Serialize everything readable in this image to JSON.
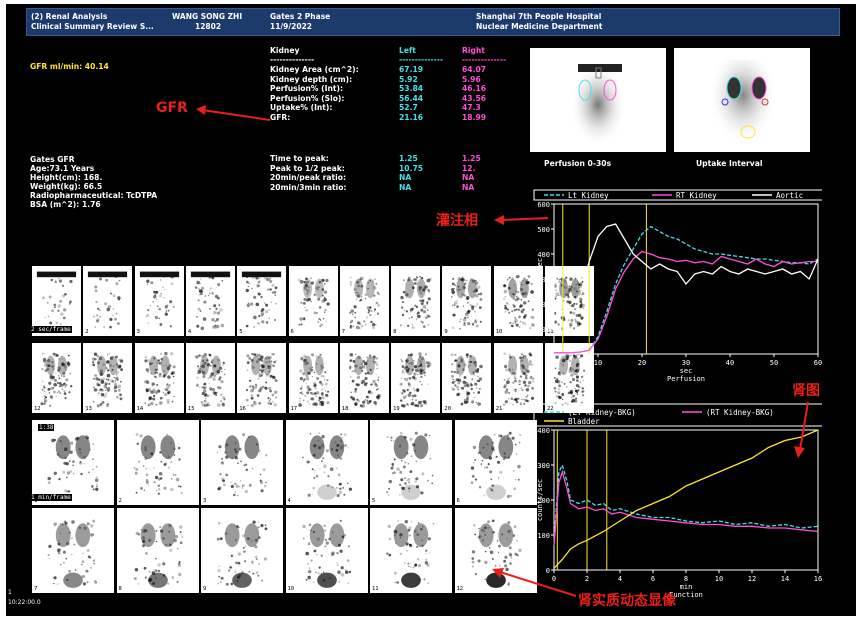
{
  "header": {
    "line1": "(2) Renal Analysis",
    "line2": "Clinical Summary Review S...",
    "patient_name": "WANG SONG ZHI",
    "patient_id": "12802",
    "protocol": "Gates 2 Phase",
    "date": "11/9/2022",
    "hospital": "Shanghai 7th People Hospital",
    "department": "Nuclear Medicine Department"
  },
  "gfr_total": "GFR ml/min: 40.14",
  "patient_info": {
    "title": "Gates GFR",
    "age": "Age:73.1 Years",
    "height": "Height(cm): 168.",
    "weight": "Weight(kg): 66.5",
    "radiopharm": "Radiopharmaceutical: TcDTPA",
    "bsa": "BSA (m^2): 1.76"
  },
  "kidney_table": {
    "header_label": "Kidney",
    "header_left": "Left",
    "header_right": "Right",
    "sep_label": "--------------",
    "sep_left": "--------------",
    "sep_right": "--------------",
    "rows": [
      {
        "label": "Kidney Area (cm^2):",
        "left": "67.19",
        "right": "64.07"
      },
      {
        "label": "Kidney depth (cm):",
        "left": "5.92",
        "right": "5.96"
      },
      {
        "label": "Perfusion% (Int):",
        "left": "53.84",
        "right": "46.16"
      },
      {
        "label": "Perfusion% (Slo):",
        "left": "56.44",
        "right": "43.56"
      },
      {
        "label": "Uptake% (Int):",
        "left": "52.7",
        "right": "47.3"
      },
      {
        "label": "GFR:",
        "left": "21.16",
        "right": "18.99"
      }
    ],
    "rows2": [
      {
        "label": "Time to peak:",
        "left": "1.25",
        "right": "1.25"
      },
      {
        "label": "Peak to 1/2 peak:",
        "left": "10.75",
        "right": "12."
      },
      {
        "label": "20min/peak ratio:",
        "left": "NA",
        "right": "NA"
      },
      {
        "label": "20min/3min ratio:",
        "left": "NA",
        "right": "NA"
      }
    ]
  },
  "images": {
    "perfusion_caption": "Perfusion 0-30s",
    "uptake_caption": "Uptake Interval"
  },
  "dynamic": {
    "row1_label": "2 sec/frame",
    "row3_label": "1 min/frame",
    "row3_time": "1:38",
    "perf_numbers": [
      "1",
      "2",
      "3",
      "4",
      "5",
      "6",
      "7",
      "8",
      "9",
      "10",
      "11",
      "12",
      "13",
      "14",
      "15",
      "16",
      "17",
      "18",
      "19",
      "20",
      "21",
      "22"
    ],
    "func_numbers": [
      "1",
      "2",
      "3",
      "4",
      "5",
      "6",
      "7",
      "8",
      "9",
      "10",
      "11",
      "12"
    ]
  },
  "footer": {
    "page": "1",
    "time": "10:22:00.0"
  },
  "annotations": {
    "gfr": "GFR",
    "perfusion": "灌注相",
    "renogram": "肾图",
    "dynamic": "肾实质动态显像"
  },
  "colors": {
    "cyan": "#3ee3e8",
    "magenta": "#ff4fd8",
    "yellow": "#ffe52e",
    "white": "#ffffff",
    "annotation_red": "#e8201a"
  },
  "chart_data": [
    {
      "type": "line",
      "xlabel": "sec",
      "xlabel2": "Perfusion",
      "ylabel": "counts/sec",
      "xlim": [
        0,
        60
      ],
      "ylim": [
        0,
        600
      ],
      "xticks": [
        "0",
        "10",
        "20",
        "30",
        "40",
        "50",
        "60"
      ],
      "yticks": [
        "0",
        "100",
        "200",
        "300",
        "400",
        "500",
        "600"
      ],
      "vlines": [
        2,
        8,
        21
      ],
      "legend_position": "top",
      "series": [
        {
          "name": "Lt Kidney",
          "color": "#3ee3e8",
          "dashed": true,
          "x": [
            0,
            2,
            4,
            6,
            8,
            10,
            12,
            14,
            16,
            18,
            20,
            22,
            24,
            26,
            28,
            30,
            32,
            34,
            36,
            38,
            40,
            42,
            44,
            46,
            48,
            50,
            52,
            54,
            56,
            58,
            60
          ],
          "y": [
            5,
            5,
            5,
            8,
            15,
            70,
            170,
            280,
            360,
            420,
            480,
            510,
            490,
            470,
            460,
            440,
            420,
            410,
            400,
            400,
            395,
            390,
            385,
            380,
            380,
            375,
            370,
            365,
            365,
            360,
            380
          ]
        },
        {
          "name": "RT Kidney",
          "color": "#ff4fd8",
          "dashed": false,
          "x": [
            0,
            2,
            4,
            6,
            8,
            10,
            12,
            14,
            16,
            18,
            20,
            22,
            24,
            26,
            28,
            30,
            32,
            34,
            36,
            38,
            40,
            42,
            44,
            46,
            48,
            50,
            52,
            54,
            56,
            58,
            60
          ],
          "y": [
            5,
            5,
            5,
            8,
            15,
            60,
            150,
            260,
            330,
            380,
            410,
            400,
            385,
            380,
            370,
            375,
            365,
            370,
            360,
            390,
            380,
            370,
            360,
            380,
            360,
            350,
            370,
            360,
            365,
            370,
            370
          ]
        },
        {
          "name": "Aortic",
          "color": "#ffffff",
          "dashed": false,
          "x": [
            0,
            2,
            4,
            6,
            8,
            10,
            12,
            14,
            16,
            18,
            20,
            22,
            24,
            26,
            28,
            30,
            32,
            34,
            36,
            38,
            40,
            42,
            44,
            46,
            48,
            50,
            52,
            54,
            56,
            58,
            60
          ],
          "y": [
            190,
            170,
            200,
            230,
            370,
            470,
            510,
            520,
            460,
            400,
            370,
            340,
            360,
            340,
            330,
            280,
            320,
            330,
            320,
            350,
            330,
            320,
            340,
            330,
            320,
            330,
            340,
            320,
            330,
            300,
            380
          ]
        }
      ]
    },
    {
      "type": "line",
      "xlabel": "min",
      "xlabel2": "Function",
      "ylabel": "counts/sec",
      "xlim": [
        0,
        16
      ],
      "ylim": [
        0,
        400
      ],
      "xticks": [
        "0",
        "2",
        "4",
        "6",
        "8",
        "10",
        "12",
        "14",
        "16"
      ],
      "yticks": [
        "0",
        "100",
        "200",
        "300",
        "400"
      ],
      "vlines": [
        0.2,
        2,
        3.2
      ],
      "legend_position": "top",
      "series": [
        {
          "name": "(LT Kidney-BKG)",
          "color": "#3ee3e8",
          "dashed": true,
          "x": [
            0,
            0.3,
            0.5,
            0.8,
            1,
            1.5,
            2,
            2.5,
            3,
            3.5,
            4,
            5,
            6,
            7,
            8,
            9,
            10,
            11,
            12,
            13,
            14,
            15,
            16
          ],
          "y": [
            80,
            280,
            300,
            250,
            200,
            190,
            200,
            185,
            190,
            170,
            175,
            160,
            150,
            150,
            140,
            135,
            140,
            130,
            135,
            125,
            130,
            120,
            125
          ]
        },
        {
          "name": "(RT Kidney-BKG)",
          "color": "#ff4fd8",
          "dashed": false,
          "x": [
            0,
            0.3,
            0.5,
            0.8,
            1,
            1.5,
            2,
            2.5,
            3,
            3.5,
            4,
            5,
            6,
            7,
            8,
            9,
            10,
            11,
            12,
            13,
            14,
            15,
            16
          ],
          "y": [
            70,
            250,
            280,
            230,
            190,
            175,
            180,
            170,
            175,
            160,
            165,
            150,
            145,
            140,
            135,
            130,
            130,
            125,
            125,
            120,
            120,
            115,
            110
          ]
        },
        {
          "name": "Bladder",
          "color": "#ffe52e",
          "dashed": false,
          "x": [
            0,
            0.5,
            1,
            1.5,
            2,
            3,
            4,
            5,
            6,
            7,
            8,
            9,
            10,
            11,
            12,
            13,
            14,
            15,
            16
          ],
          "y": [
            5,
            30,
            60,
            75,
            85,
            110,
            140,
            170,
            190,
            210,
            240,
            260,
            280,
            300,
            320,
            350,
            370,
            380,
            400
          ]
        }
      ]
    }
  ]
}
